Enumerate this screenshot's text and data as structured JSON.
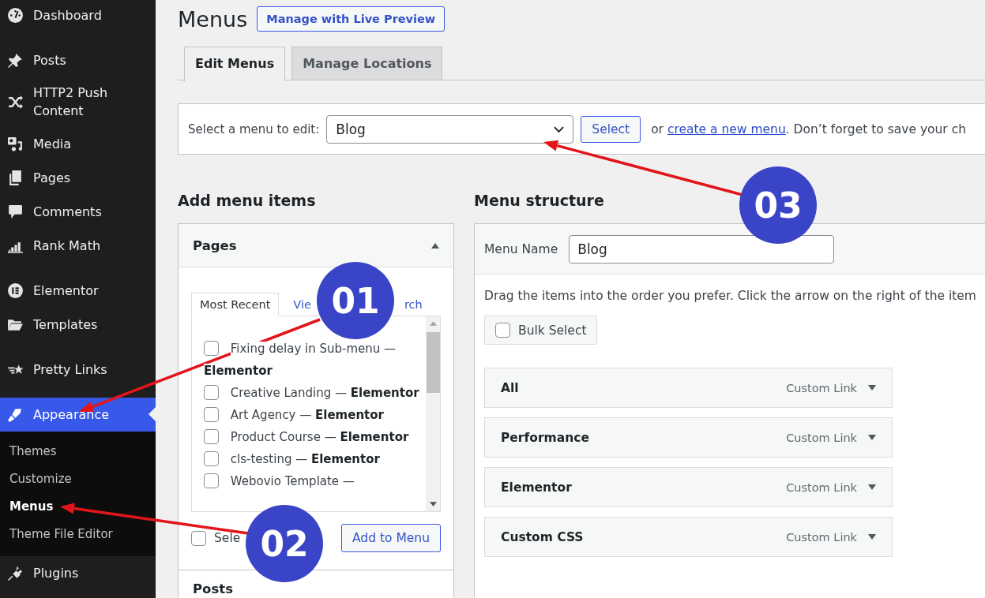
{
  "sidebar": {
    "items": [
      {
        "kind": "item",
        "label": "Dashboard",
        "selected": false
      },
      {
        "kind": "separator"
      },
      {
        "kind": "item",
        "label": "Posts",
        "selected": false
      },
      {
        "kind": "item",
        "label": "HTTP2 Push Content",
        "selected": false
      },
      {
        "kind": "item",
        "label": "Media",
        "selected": false
      },
      {
        "kind": "item",
        "label": "Pages",
        "selected": false
      },
      {
        "kind": "item",
        "label": "Comments",
        "selected": false
      },
      {
        "kind": "item",
        "label": "Rank Math",
        "selected": false
      },
      {
        "kind": "separator"
      },
      {
        "kind": "item",
        "label": "Elementor",
        "selected": false
      },
      {
        "kind": "item",
        "label": "Templates",
        "selected": false
      },
      {
        "kind": "separator"
      },
      {
        "kind": "item",
        "label": "Pretty Links",
        "selected": false
      },
      {
        "kind": "separator"
      },
      {
        "kind": "item",
        "label": "Appearance",
        "selected": true,
        "children": [
          {
            "label": "Themes",
            "selected": false
          },
          {
            "label": "Customize",
            "selected": false
          },
          {
            "label": "Menus",
            "selected": true
          },
          {
            "label": "Theme File Editor",
            "selected": false
          }
        ]
      },
      {
        "kind": "item",
        "label": "Plugins",
        "selected": false
      }
    ]
  },
  "page": {
    "title": "Menus",
    "action_button": "Manage with Live Preview"
  },
  "tabs": [
    {
      "label": "Edit Menus",
      "selected": true
    },
    {
      "label": "Manage Locations",
      "selected": false
    }
  ],
  "menu_select": {
    "label": "Select a menu to edit:",
    "value": "Blog",
    "button": "Select",
    "hint_before": "or",
    "link": "create a new menu",
    "hint_after": ". Don’t forget to save your ch"
  },
  "add_items": {
    "heading": "Add menu items",
    "section": "Pages",
    "expanded": true,
    "tabs": [
      {
        "label": "Most Recent",
        "selected": true
      },
      {
        "label": "Vie",
        "selected": false
      },
      {
        "label": "rch",
        "selected": false
      }
    ],
    "pages": [
      {
        "text": "Fixing delay in Sub-menu — **Elementor**",
        "checked": false
      },
      {
        "text": "Creative Landing — **Elementor**",
        "checked": false
      },
      {
        "text": "Art Agency — **Elementor**",
        "checked": false
      },
      {
        "text": "Product Course — **Elementor**",
        "checked": false
      },
      {
        "text": "cls-testing — **Elementor**",
        "checked": false
      },
      {
        "text": "Webovio Template —",
        "checked": false
      }
    ],
    "select_all": {
      "label": "Sele",
      "checked": false
    },
    "button": "Add to Menu",
    "next_section": "Posts"
  },
  "structure": {
    "heading": "Menu structure",
    "name_label": "Menu Name",
    "name_value": "Blog",
    "instructions": "Drag the items into the order you prefer. Click the arrow on the right of the item",
    "bulk_select": {
      "label": "Bulk Select",
      "checked": false
    },
    "items": [
      {
        "title": "All",
        "type": "Custom Link"
      },
      {
        "title": "Performance",
        "type": "Custom Link"
      },
      {
        "title": "Elementor",
        "type": "Custom Link"
      },
      {
        "title": "Custom CSS",
        "type": "Custom Link"
      }
    ]
  },
  "callouts": [
    {
      "label": "01"
    },
    {
      "label": "02"
    },
    {
      "label": "03"
    }
  ]
}
